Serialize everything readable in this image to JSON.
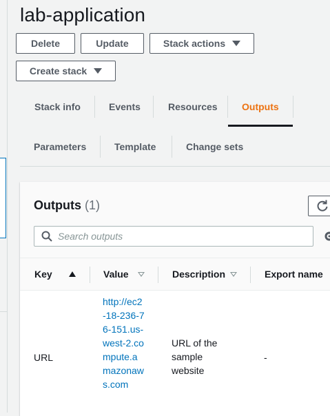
{
  "stack": {
    "title": "lab-application"
  },
  "buttons": {
    "delete": "Delete",
    "update": "Update",
    "stack_actions": "Stack actions",
    "create_stack": "Create stack"
  },
  "tabs": {
    "stack_info": "Stack info",
    "events": "Events",
    "resources": "Resources",
    "outputs": "Outputs",
    "parameters": "Parameters",
    "template": "Template",
    "change_sets": "Change sets",
    "active": "Outputs"
  },
  "outputs_panel": {
    "title": "Outputs",
    "count": "(1)",
    "search_placeholder": "Search outputs"
  },
  "table": {
    "columns": [
      "Key",
      "Value",
      "Description",
      "Export name"
    ],
    "rows": [
      {
        "key": "URL",
        "value": "http://ec2-18-236-76-151.us-west-2.compute.amazonaws.com",
        "description": "URL of the sample website",
        "export_name": "-"
      }
    ]
  },
  "colors": {
    "accent": "#ec7211",
    "link": "#0073bb",
    "text": "#16191f",
    "muted": "#545b64"
  }
}
